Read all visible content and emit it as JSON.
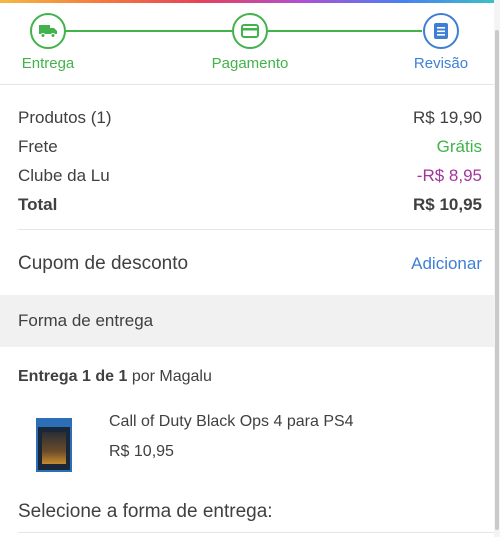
{
  "colors": {
    "green": "#41b34a",
    "blue": "#3e7fd6",
    "purple": "#a2359c",
    "section_bg": "#f1f1f1"
  },
  "stepper": {
    "steps": [
      {
        "label": "Entrega",
        "icon": "truck-icon",
        "state": "done"
      },
      {
        "label": "Pagamento",
        "icon": "credit-card-icon",
        "state": "done"
      },
      {
        "label": "Revisão",
        "icon": "document-icon",
        "state": "active"
      }
    ]
  },
  "summary": {
    "products_label": "Produtos (1)",
    "products_value": "R$ 19,90",
    "shipping_label": "Frete",
    "shipping_value": "Grátis",
    "club_label": "Clube da Lu",
    "club_value": "-R$ 8,95",
    "total_label": "Total",
    "total_value": "R$ 10,95"
  },
  "coupon": {
    "label": "Cupom de desconto",
    "action": "Adicionar"
  },
  "delivery_section": {
    "title": "Forma de entrega",
    "info_bold": "Entrega 1 de 1",
    "info_rest": " por Magalu"
  },
  "product": {
    "name": "Call of Duty Black Ops 4 para PS4",
    "price": "R$ 10,95",
    "image_icon": "game-cover-image"
  },
  "select_delivery_title": "Selecione a forma de entrega:"
}
